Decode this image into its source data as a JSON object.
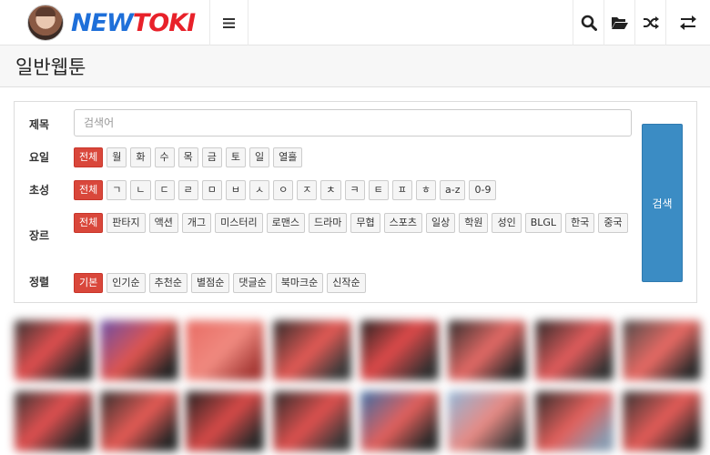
{
  "header": {
    "logo_new": "NEW",
    "logo_toki": "TOKI",
    "menu_icon": "hamburger-icon",
    "actions": [
      "search-icon",
      "folder-open-icon",
      "shuffle-icon",
      "swap-icon"
    ]
  },
  "page": {
    "title": "일반웹툰"
  },
  "search": {
    "title_label": "제목",
    "placeholder": "검색어",
    "submit_label": "검색",
    "day": {
      "label": "요일",
      "options": [
        "전체",
        "월",
        "화",
        "수",
        "목",
        "금",
        "토",
        "일",
        "열흘"
      ],
      "selected": "전체"
    },
    "initial": {
      "label": "초성",
      "options": [
        "전체",
        "ㄱ",
        "ㄴ",
        "ㄷ",
        "ㄹ",
        "ㅁ",
        "ㅂ",
        "ㅅ",
        "ㅇ",
        "ㅈ",
        "ㅊ",
        "ㅋ",
        "ㅌ",
        "ㅍ",
        "ㅎ",
        "a-z",
        "0-9"
      ],
      "selected": "전체"
    },
    "genre": {
      "label": "장르",
      "options": [
        "전체",
        "판타지",
        "액션",
        "개그",
        "미스터리",
        "로맨스",
        "드라마",
        "무협",
        "스포츠",
        "일상",
        "학원",
        "성인",
        "BLGL",
        "한국",
        "중국"
      ],
      "selected": "전체"
    },
    "sort": {
      "label": "정렬",
      "options": [
        "기본",
        "인기순",
        "추천순",
        "별점순",
        "댓글순",
        "북마크순",
        "신작순"
      ],
      "selected": "기본"
    }
  },
  "colors": {
    "active_chip": "#d9473b",
    "submit": "#3b8cc4",
    "logo_blue": "#1e6fd9",
    "logo_red": "#e8212a"
  }
}
